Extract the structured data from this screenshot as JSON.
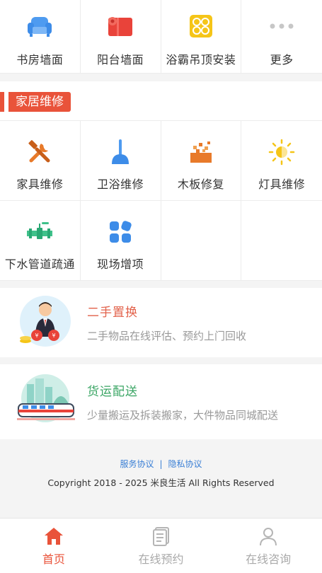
{
  "top_grid": {
    "items": [
      {
        "label": "书房墙面",
        "icon": "sofa-icon"
      },
      {
        "label": "阳台墙面",
        "icon": "wallpaper-roll-icon"
      },
      {
        "label": "浴霸吊顶安装",
        "icon": "bath-heater-icon"
      },
      {
        "label": "更多",
        "icon": "more-icon"
      }
    ]
  },
  "section": {
    "title": "家居维修",
    "accent": "#e9533a"
  },
  "repair_grid": {
    "items": [
      {
        "label": "家具维修",
        "icon": "tools-icon"
      },
      {
        "label": "卫浴维修",
        "icon": "plunger-icon"
      },
      {
        "label": "木板修复",
        "icon": "wood-board-icon"
      },
      {
        "label": "灯具维修",
        "icon": "light-icon"
      },
      {
        "label": "下水管道疏通",
        "icon": "pipe-icon"
      },
      {
        "label": "现场增项",
        "icon": "apps-icon"
      }
    ]
  },
  "cards": [
    {
      "title": "二手置换",
      "subtitle": "二手物品在线评估、预约上门回收",
      "title_color": "#e2614a",
      "icon": "secondhand-illustration"
    },
    {
      "title": "货运配送",
      "subtitle": "少量搬运及拆装搬家，大件物品同城配送",
      "title_color": "#3aa564",
      "icon": "freight-illustration"
    }
  ],
  "footer": {
    "service_agreement": "服务协议",
    "privacy_agreement": "隐私协议",
    "separator": "|",
    "copyright": "Copyright 2018 - 2025 米良生活 All Rights Reserved"
  },
  "tabbar": {
    "tabs": [
      {
        "label": "首页",
        "icon": "home-icon",
        "active": true
      },
      {
        "label": "在线预约",
        "icon": "booking-icon",
        "active": false
      },
      {
        "label": "在线咨询",
        "icon": "user-icon",
        "active": false
      }
    ]
  }
}
